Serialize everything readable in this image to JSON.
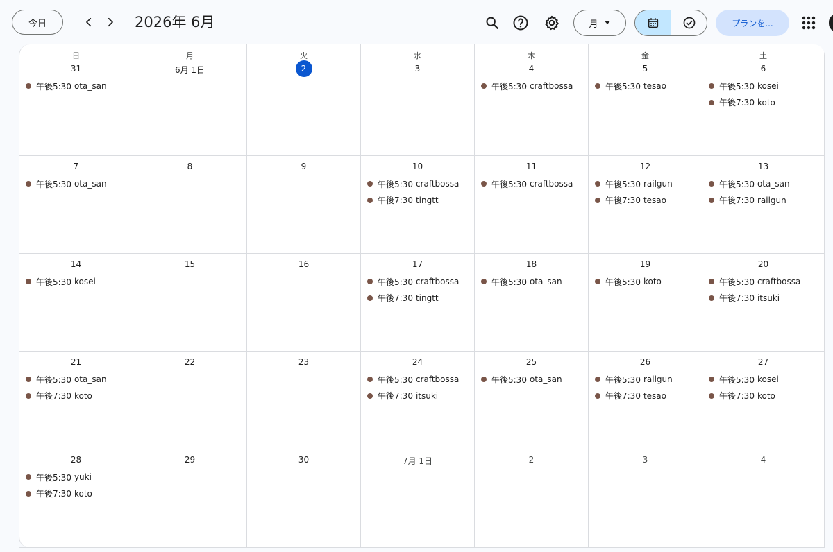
{
  "header": {
    "today_label": "今日",
    "month_title": "2026年 6月",
    "view_label": "月",
    "plan_label": "プランを..."
  },
  "colors": {
    "event_dot": "#795548",
    "today_accent": "#0b57d0",
    "toggle_active": "#c2e7ff"
  },
  "weekdays": [
    "日",
    "月",
    "火",
    "水",
    "木",
    "金",
    "土"
  ],
  "weeks": [
    [
      {
        "label": "31",
        "events": [
          {
            "time": "午後5:30",
            "title": "ota_san"
          }
        ]
      },
      {
        "label": "6月 1日",
        "events": []
      },
      {
        "label": "2",
        "today": true,
        "events": []
      },
      {
        "label": "3",
        "events": []
      },
      {
        "label": "4",
        "events": [
          {
            "time": "午後5:30",
            "title": "craftbossa"
          }
        ]
      },
      {
        "label": "5",
        "events": [
          {
            "time": "午後5:30",
            "title": "tesao"
          }
        ]
      },
      {
        "label": "6",
        "events": [
          {
            "time": "午後5:30",
            "title": "kosei"
          },
          {
            "time": "午後7:30",
            "title": "koto"
          }
        ]
      }
    ],
    [
      {
        "label": "7",
        "events": [
          {
            "time": "午後5:30",
            "title": "ota_san"
          }
        ]
      },
      {
        "label": "8",
        "events": []
      },
      {
        "label": "9",
        "events": []
      },
      {
        "label": "10",
        "events": [
          {
            "time": "午後5:30",
            "title": "craftbossa"
          },
          {
            "time": "午後7:30",
            "title": "tingtt"
          }
        ]
      },
      {
        "label": "11",
        "events": [
          {
            "time": "午後5:30",
            "title": "craftbossa"
          }
        ]
      },
      {
        "label": "12",
        "events": [
          {
            "time": "午後5:30",
            "title": "railgun"
          },
          {
            "time": "午後7:30",
            "title": "tesao"
          }
        ]
      },
      {
        "label": "13",
        "events": [
          {
            "time": "午後5:30",
            "title": "ota_san"
          },
          {
            "time": "午後7:30",
            "title": "railgun"
          }
        ]
      }
    ],
    [
      {
        "label": "14",
        "events": [
          {
            "time": "午後5:30",
            "title": "kosei"
          }
        ]
      },
      {
        "label": "15",
        "events": []
      },
      {
        "label": "16",
        "events": []
      },
      {
        "label": "17",
        "events": [
          {
            "time": "午後5:30",
            "title": "craftbossa"
          },
          {
            "time": "午後7:30",
            "title": "tingtt"
          }
        ]
      },
      {
        "label": "18",
        "events": [
          {
            "time": "午後5:30",
            "title": "ota_san"
          }
        ]
      },
      {
        "label": "19",
        "events": [
          {
            "time": "午後5:30",
            "title": "koto"
          }
        ]
      },
      {
        "label": "20",
        "events": [
          {
            "time": "午後5:30",
            "title": "craftbossa"
          },
          {
            "time": "午後7:30",
            "title": "itsuki"
          }
        ]
      }
    ],
    [
      {
        "label": "21",
        "events": [
          {
            "time": "午後5:30",
            "title": "ota_san"
          },
          {
            "time": "午後7:30",
            "title": "koto"
          }
        ]
      },
      {
        "label": "22",
        "events": []
      },
      {
        "label": "23",
        "events": []
      },
      {
        "label": "24",
        "events": [
          {
            "time": "午後5:30",
            "title": "craftbossa"
          },
          {
            "time": "午後7:30",
            "title": "itsuki"
          }
        ]
      },
      {
        "label": "25",
        "events": [
          {
            "time": "午後5:30",
            "title": "ota_san"
          }
        ]
      },
      {
        "label": "26",
        "events": [
          {
            "time": "午後5:30",
            "title": "railgun"
          },
          {
            "time": "午後7:30",
            "title": "tesao"
          }
        ]
      },
      {
        "label": "27",
        "events": [
          {
            "time": "午後5:30",
            "title": "kosei"
          },
          {
            "time": "午後7:30",
            "title": "koto"
          }
        ]
      }
    ],
    [
      {
        "label": "28",
        "events": [
          {
            "time": "午後5:30",
            "title": "yuki"
          },
          {
            "time": "午後7:30",
            "title": "koto"
          }
        ]
      },
      {
        "label": "29",
        "events": []
      },
      {
        "label": "30",
        "events": []
      },
      {
        "label": "7月 1日",
        "other": true,
        "events": []
      },
      {
        "label": "2",
        "other": true,
        "events": []
      },
      {
        "label": "3",
        "other": true,
        "events": []
      },
      {
        "label": "4",
        "other": true,
        "events": []
      }
    ]
  ]
}
